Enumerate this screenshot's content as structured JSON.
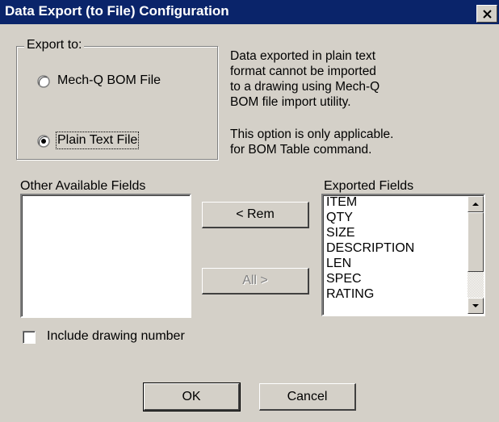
{
  "window": {
    "title": "Data Export (to File) Configuration",
    "close_glyph": "✕"
  },
  "export_group": {
    "legend": "Export to:",
    "options": [
      {
        "label": "Mech-Q BOM File",
        "selected": false
      },
      {
        "label": "Plain Text File",
        "selected": true
      }
    ]
  },
  "info": {
    "lines_a": [
      "Data exported in plain text",
      "format cannot be imported",
      "to a drawing using Mech-Q",
      "BOM file import utility."
    ],
    "lines_b": [
      "This option is only applicable.",
      "for BOM Table command."
    ]
  },
  "available": {
    "label": "Other Available Fields",
    "items": []
  },
  "exported": {
    "label": "Exported Fields",
    "items": [
      "ITEM",
      "QTY",
      "SIZE",
      "DESCRIPTION",
      "LEN",
      "SPEC",
      "RATING"
    ]
  },
  "buttons": {
    "rem": "< Rem",
    "all": "All >",
    "ok": "OK",
    "cancel": "Cancel"
  },
  "checkbox": {
    "label": "Include drawing number",
    "checked": false
  }
}
